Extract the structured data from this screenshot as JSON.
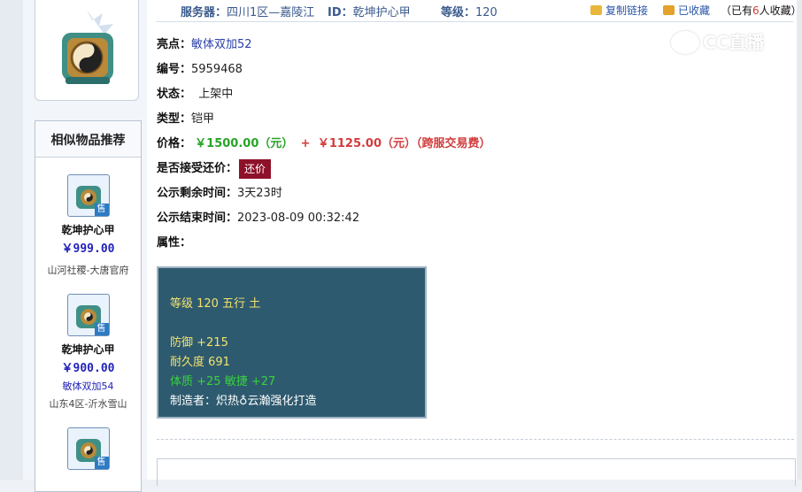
{
  "header": {
    "server_label": "服务器：",
    "server_value": "四川1区—嘉陵江",
    "id_label": "ID：",
    "id_value": "乾坤护心甲",
    "level_label": "等级：",
    "level_value": "120",
    "copy_link": "复制链接",
    "favorited": "已收藏",
    "fav_count_prefix": "（已有",
    "fav_count": "6",
    "fav_count_suffix": "人收藏）"
  },
  "watermark": "CC直播",
  "sidebar": {
    "title": "相似物品推荐",
    "items": [
      {
        "name": "乾坤护心甲",
        "price": "￥999.00",
        "tag": "",
        "server": "山河社稷-大唐官府",
        "badge": "售"
      },
      {
        "name": "乾坤护心甲",
        "price": "￥900.00",
        "tag": "敏体双加54",
        "server": "山东4区-沂水雪山",
        "badge": "售"
      },
      {
        "name": "",
        "price": "",
        "tag": "",
        "server": "",
        "badge": "售"
      }
    ]
  },
  "info": {
    "highlight_label": "亮点：",
    "highlight_value": "敏体双加52",
    "number_label": "编号：",
    "number_value": "5959468",
    "status_label": "状态：",
    "status_value": "上架中",
    "type_label": "类型：",
    "type_value": "铠甲",
    "price_label": "价格：",
    "price_main": "￥1500.00（元）",
    "price_plus": "+",
    "price_fee": "￥1125.00（元）（跨服交易费）",
    "counter_label": "是否接受还价：",
    "counter_button": "还价",
    "remaining_label": "公示剩余时间：",
    "remaining_value": "3天23时",
    "end_label": "公示结束时间：",
    "end_value": "2023-08-09 00:32:42",
    "attr_label": "属性："
  },
  "attributes": {
    "line1": "等级 120 五行 土",
    "line2": "防御 +215",
    "line3": "耐久度 691",
    "line4": "体质 +25 敏捷 +27",
    "line5": "制造者：炽热♁云瀚强化打造"
  },
  "colors": {
    "accent_blue": "#3a5a8c",
    "price_green": "#27a427",
    "price_red": "#d23c3c",
    "counter_button_bg": "#8d1129",
    "attr_bg": "#2e5a6f"
  }
}
